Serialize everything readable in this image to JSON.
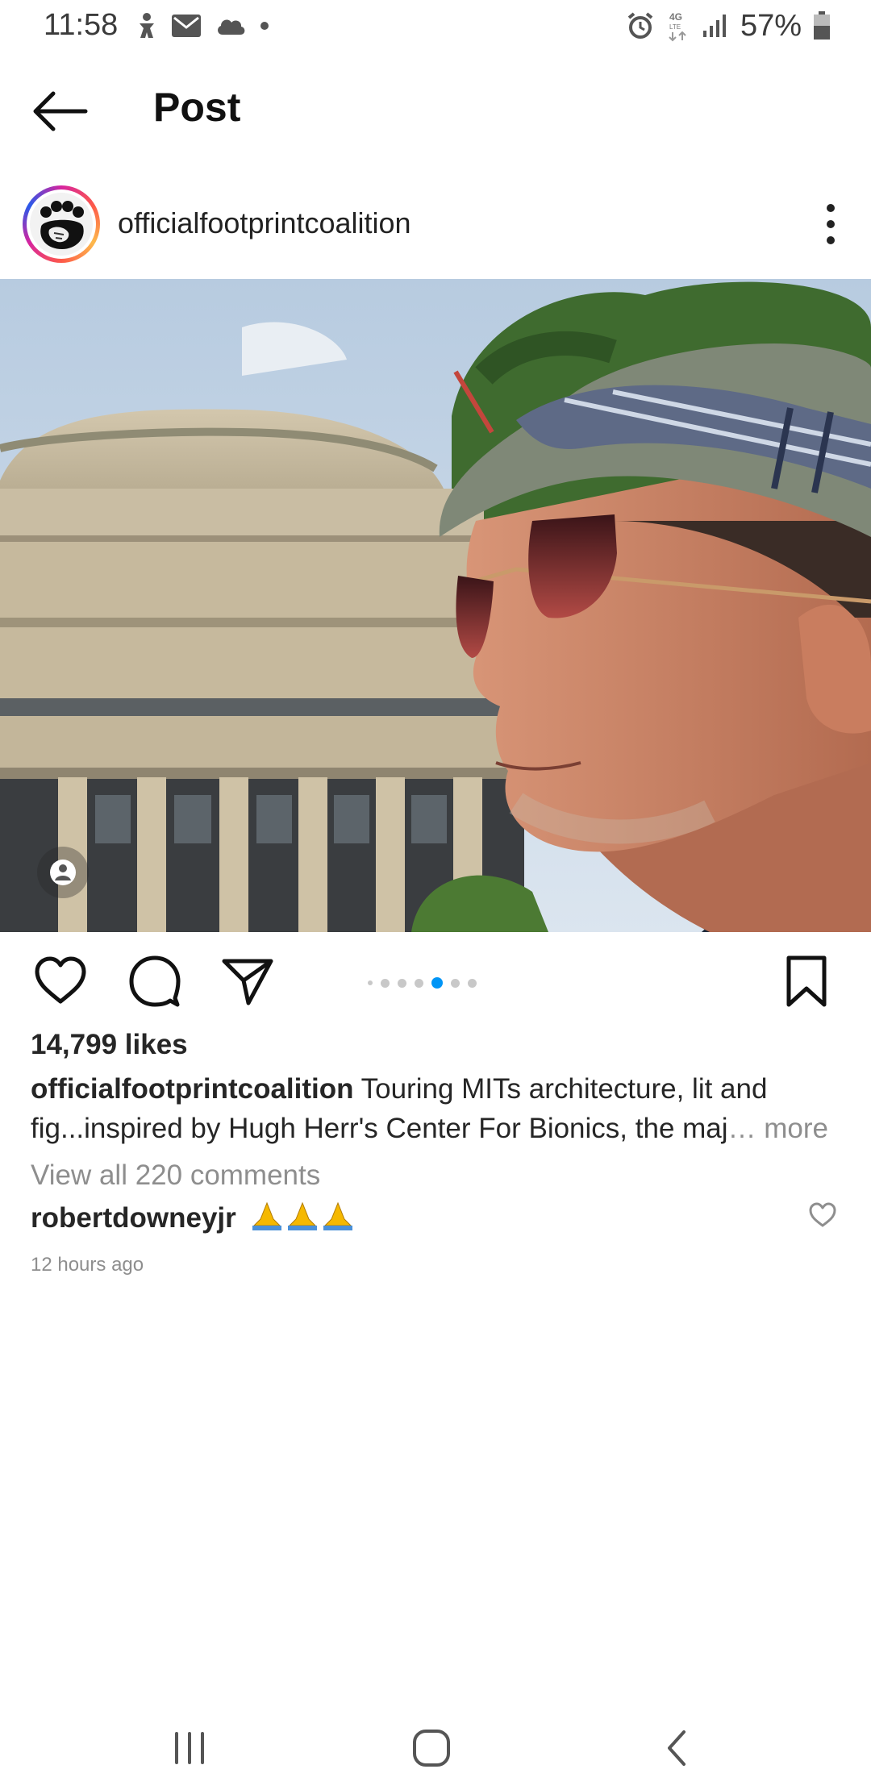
{
  "status_bar": {
    "time": "11:58",
    "battery_percent": "57%",
    "left_icons": [
      "accessibility-icon",
      "mail-icon",
      "cloud-icon",
      "dot-icon"
    ],
    "right_icons": [
      "alarm-icon",
      "4g-lte-icon",
      "signal-icon",
      "battery-icon"
    ]
  },
  "header": {
    "title": "Post",
    "back_icon": "arrow-left-icon"
  },
  "post": {
    "author": "officialfootprintcoalition",
    "more_icon": "more-vertical-icon",
    "carousel": {
      "count": 7,
      "active_index": 4
    },
    "likes": "14,799 likes",
    "caption_user": "officialfootprintcoalition",
    "caption_text": " Touring MITs architecture, lit and fig...inspired by Hugh Herr's Center For Bionics, the maj",
    "caption_more": "… more",
    "view_comments": "View all 220 comments",
    "comment": {
      "user": "robertdowneyjr",
      "emoji": "🙏🙏🙏"
    },
    "timestamp": "12 hours ago"
  },
  "colors": {
    "accent": "#0095f6",
    "text": "#262626",
    "muted": "#8e8e8e"
  }
}
